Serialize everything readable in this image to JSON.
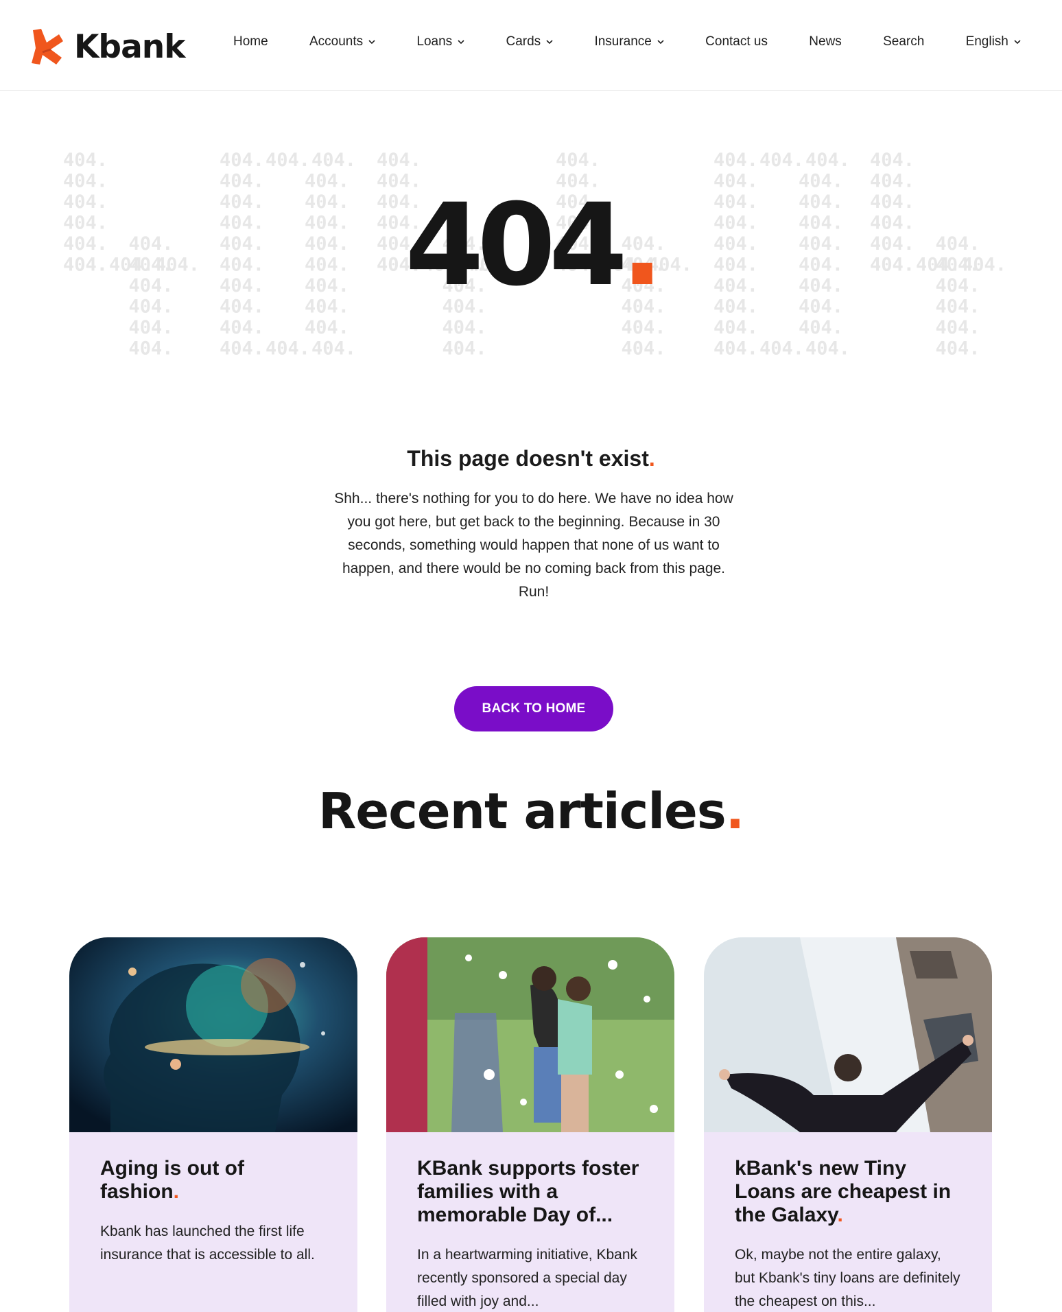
{
  "brand": {
    "name": "Kbank",
    "accent": "#f0561d",
    "button_color": "#7a0dc8"
  },
  "nav": {
    "items": [
      {
        "label": "Home",
        "dropdown": false
      },
      {
        "label": "Accounts",
        "dropdown": true
      },
      {
        "label": "Loans",
        "dropdown": true
      },
      {
        "label": "Cards",
        "dropdown": true
      },
      {
        "label": "Insurance",
        "dropdown": true
      },
      {
        "label": "Contact us",
        "dropdown": false
      },
      {
        "label": "News",
        "dropdown": false
      },
      {
        "label": "Search",
        "dropdown": false
      },
      {
        "label": "English",
        "dropdown": true
      }
    ]
  },
  "hero": {
    "code": "404",
    "dot": ".",
    "pattern_text": "404."
  },
  "message": {
    "title": "This page doesn't exist",
    "dot": ".",
    "body": "Shh... there's nothing for you to do here. We have no idea how you got here, but get back to the beginning. Because in 30 seconds, something would happen that none of us want to happen, and there would be no coming back from this page. Run!"
  },
  "back_button": {
    "label": "BACK TO HOME"
  },
  "recent": {
    "title": "Recent articles",
    "dot": ".",
    "articles": [
      {
        "title": "Aging is out of fashion",
        "excerpt": "Kbank has launched the first life insurance that is accessible to all.",
        "image": "cosmic-head-image"
      },
      {
        "title": "KBank supports foster families with a memorable Day of...",
        "excerpt": "In a heartwarming initiative, Kbank recently sponsored a special day filled with joy and...",
        "image": "children-foam-party-image"
      },
      {
        "title": "kBank's new Tiny Loans are cheapest in the Galaxy",
        "excerpt": "Ok, maybe not the entire galaxy, but Kbank's tiny loans are definitely the cheapest on this...",
        "image": "businessman-skyscrapers-image"
      }
    ]
  }
}
